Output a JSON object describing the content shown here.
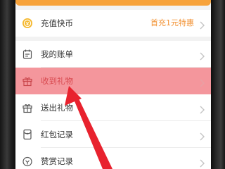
{
  "colors": {
    "accent": "#f7a23a",
    "promo": "#f29234",
    "highlight": "#f06e76",
    "annotation_arrow": "#e8222e"
  },
  "recharge": {
    "icon": "coin-icon",
    "label": "充值快币",
    "promo": "首充1元特惠"
  },
  "menu": {
    "items": [
      {
        "icon": "bill-icon",
        "label": "我的账单"
      },
      {
        "icon": "gift-icon",
        "label": "收到礼物",
        "highlighted": true
      },
      {
        "icon": "gift-box-icon",
        "label": "送出礼物"
      },
      {
        "icon": "red-packet-icon",
        "label": "红包记录"
      },
      {
        "icon": "reward-icon",
        "label": "赞赏记录"
      }
    ]
  }
}
